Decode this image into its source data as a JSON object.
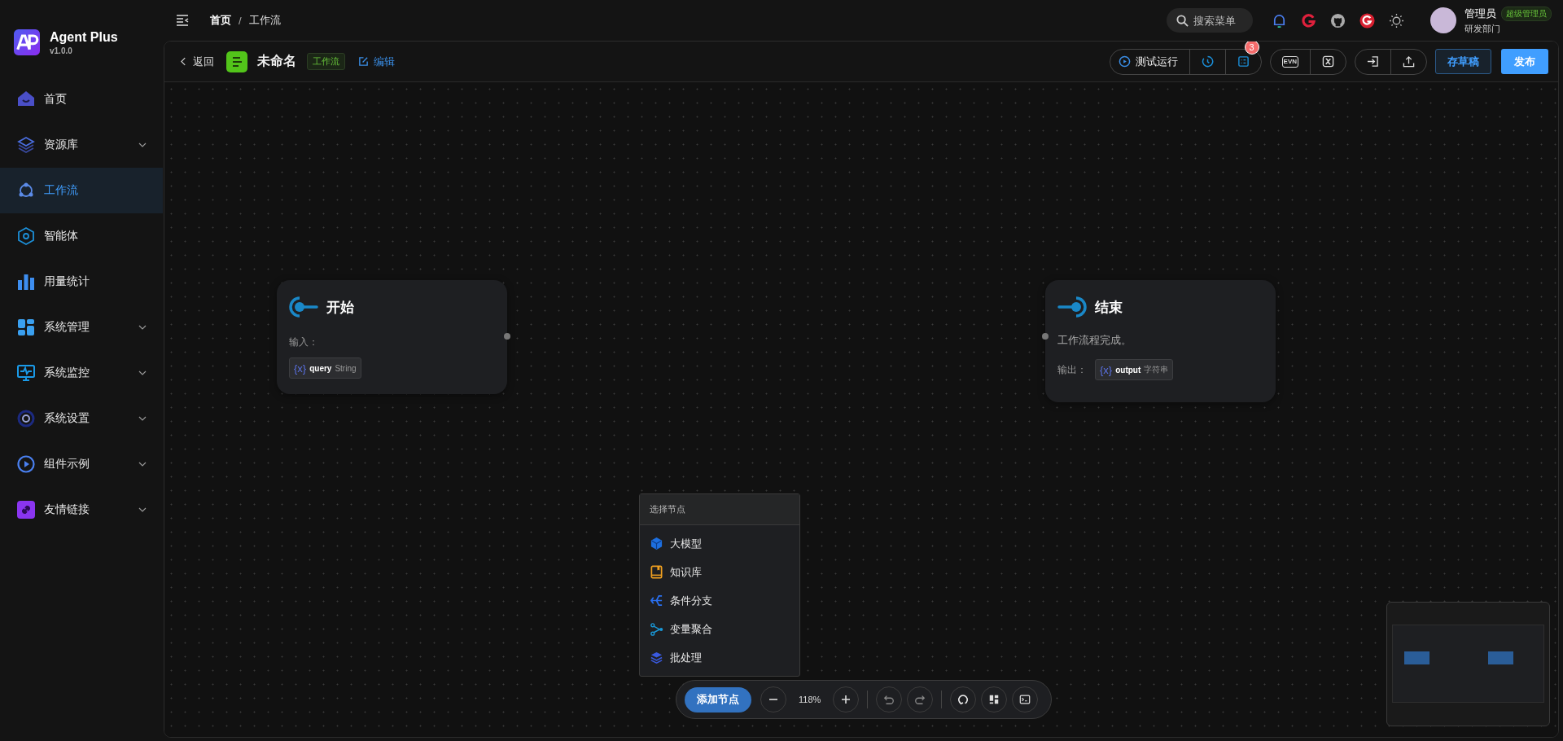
{
  "app": {
    "name": "Agent Plus",
    "version": "v1.0.0"
  },
  "sidebar": {
    "items": [
      {
        "label": "首页",
        "selected": false,
        "expandable": false
      },
      {
        "label": "资源库",
        "selected": false,
        "expandable": true
      },
      {
        "label": "工作流",
        "selected": true,
        "expandable": false
      },
      {
        "label": "智能体",
        "selected": false,
        "expandable": false
      },
      {
        "label": "用量统计",
        "selected": false,
        "expandable": false
      },
      {
        "label": "系统管理",
        "selected": false,
        "expandable": true
      },
      {
        "label": "系统监控",
        "selected": false,
        "expandable": true
      },
      {
        "label": "系统设置",
        "selected": false,
        "expandable": true
      },
      {
        "label": "组件示例",
        "selected": false,
        "expandable": true
      },
      {
        "label": "友情链接",
        "selected": false,
        "expandable": true
      }
    ]
  },
  "topbar": {
    "breadcrumb": [
      "首页",
      "工作流"
    ],
    "breadcrumb_separator": "/",
    "search": {
      "placeholder": "搜索菜单"
    },
    "user": {
      "name": "管理员",
      "role": "超级管理员",
      "department": "研发部门"
    }
  },
  "workflow_header": {
    "back": "返回",
    "title": "未命名",
    "tag": "工作流",
    "edit": "编辑",
    "test_run": "测试运行",
    "badge": "3",
    "env": "EVN",
    "save_draft": "存草稿",
    "publish": "发布"
  },
  "nodes": [
    {
      "kind": "start",
      "title": "开始",
      "label": "输入：",
      "variables": [
        {
          "symbol": "{x}",
          "name": "query",
          "type": "String"
        }
      ]
    },
    {
      "kind": "end",
      "title": "结束",
      "description": "工作流程完成。",
      "label": "输出：",
      "variables": [
        {
          "symbol": "{x}",
          "name": "output",
          "type": "字符串"
        }
      ]
    }
  ],
  "node_menu": {
    "title": "选择节点",
    "items": [
      {
        "label": "大模型"
      },
      {
        "label": "知识库"
      },
      {
        "label": "条件分支"
      },
      {
        "label": "变量聚合"
      },
      {
        "label": "批处理"
      }
    ]
  },
  "toolbar": {
    "add_node": "添加节点",
    "zoom": "118%"
  }
}
